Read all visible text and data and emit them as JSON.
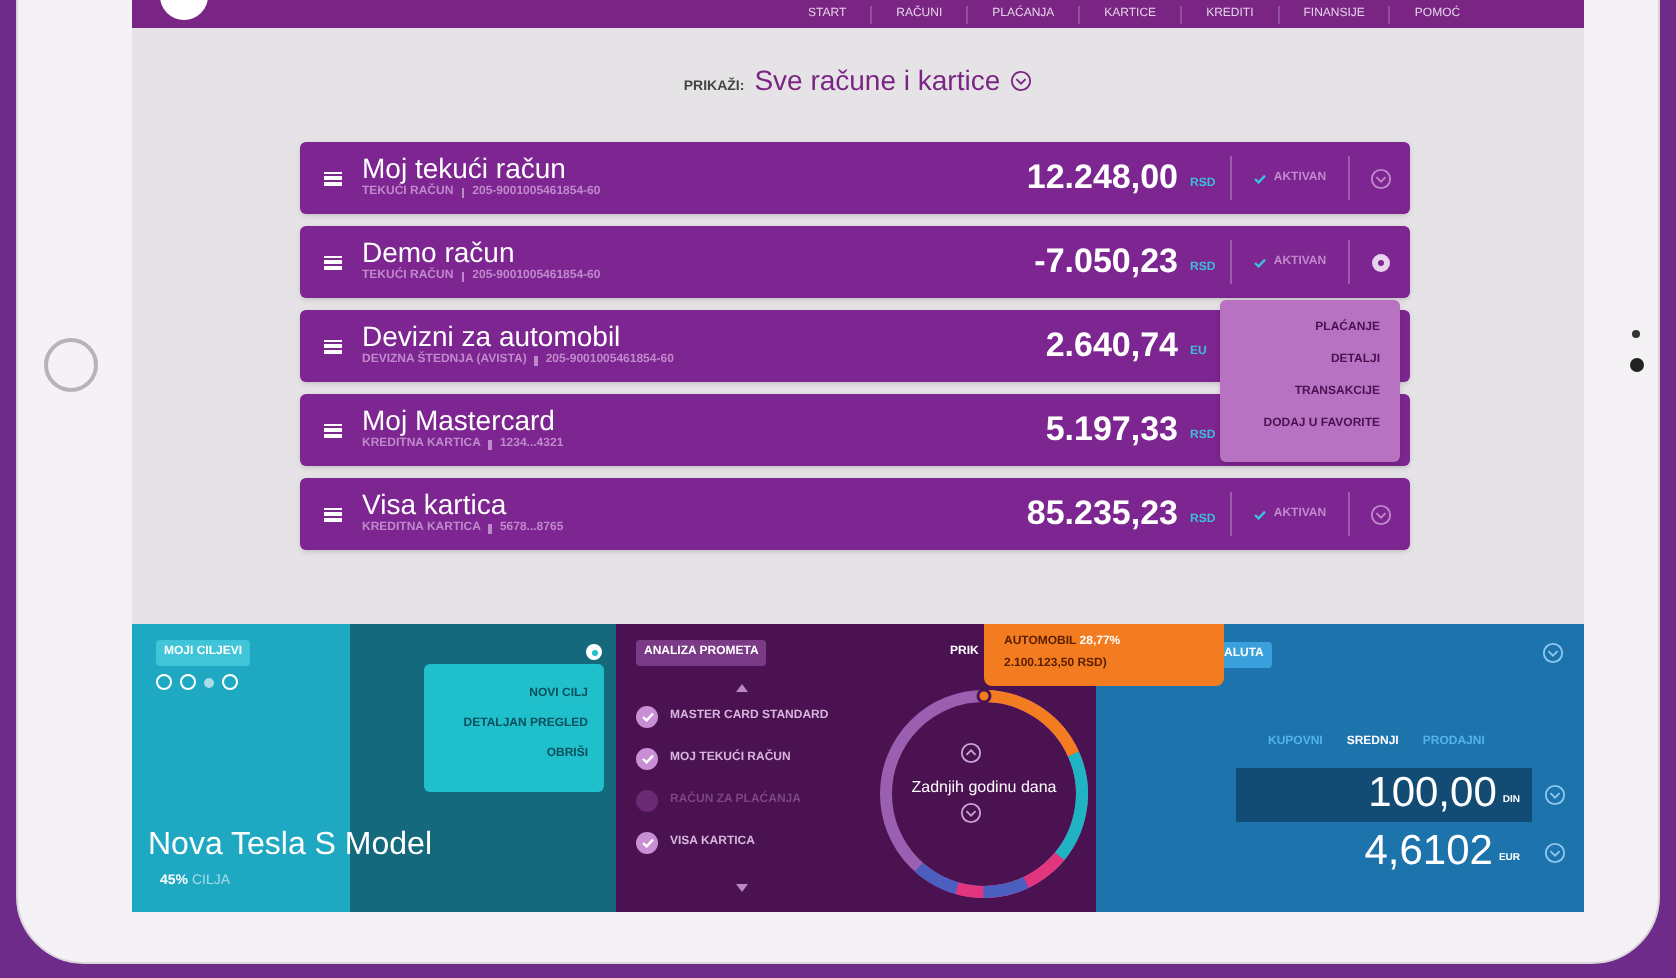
{
  "nav": {
    "items": [
      {
        "label": "START"
      },
      {
        "label": "RAČUNI"
      },
      {
        "label": "PLAĆANJA"
      },
      {
        "label": "KARTICE"
      },
      {
        "label": "KREDITI"
      },
      {
        "label": "FINANSIJE"
      },
      {
        "label": "POMOĆ"
      }
    ]
  },
  "filter": {
    "label": "PRIKAŽI:",
    "value": "Sve račune i kartice"
  },
  "accounts": [
    {
      "name": "Moj tekući račun",
      "type": "TEKUĆI RAČUN",
      "number": "205-9001005461854-60",
      "amount": "12.248,00",
      "currency": "RSD",
      "status": "AKTIVAN",
      "menu_open": false
    },
    {
      "name": "Demo račun",
      "type": "TEKUĆI RAČUN",
      "number": "205-9001005461854-60",
      "amount": "-7.050,23",
      "currency": "RSD",
      "status": "AKTIVAN",
      "menu_open": true
    },
    {
      "name": "Devizni za automobil",
      "type": "DEVIZNA ŠTEDNJA (AVISTA)",
      "number": "205-9001005461854-60",
      "amount": "2.640,74",
      "currency": "EU",
      "menu_open": false
    },
    {
      "name": "Moj Mastercard",
      "type": "KREDITNA KARTICA",
      "number": "1234...4321",
      "amount": "5.197,33",
      "currency": "RSD",
      "menu_open": false
    },
    {
      "name": "Visa kartica",
      "type": "KREDITNA KARTICA",
      "number": "5678...8765",
      "amount": "85.235,23",
      "currency": "RSD",
      "status": "AKTIVAN",
      "menu_open": false
    }
  ],
  "account_menu": {
    "items": [
      "PLAĆANJE",
      "DETALJI",
      "TRANSAKCIJE",
      "DODAJ U FAVORITE"
    ]
  },
  "goals": {
    "badge": "MOJI CILJEVI",
    "pages": [
      {
        "selected": false
      },
      {
        "selected": false
      },
      {
        "selected": true
      },
      {
        "selected": false
      }
    ],
    "title": "Nova Tesla S Model",
    "percent": "45%",
    "percent_label": "CILJA",
    "level": 0.45,
    "menu": [
      "NOVI CILJ",
      "DETALJAN PREGLED",
      "OBRIŠI"
    ]
  },
  "analysis": {
    "badge": "ANALIZA PROMETA",
    "view_label": "PRIK",
    "items": [
      {
        "label": "MASTER CARD STANDARD",
        "checked": true
      },
      {
        "label": "MOJ TEKUĆI RAČUN",
        "checked": true
      },
      {
        "label": "RAČUN ZA PLAĆANJA",
        "checked": false
      },
      {
        "label": "VISA KARTICA",
        "checked": true
      }
    ],
    "period": "Zadnjih godinu dana",
    "tooltip": {
      "label": "AUTOMOBIL",
      "percent": "28,77%",
      "amount": "2.100.123,50 RSD)"
    }
  },
  "currency": {
    "badge": "ALUTA",
    "tabs": [
      {
        "label": "KUPOVNI",
        "selected": false
      },
      {
        "label": "SREDNJI",
        "selected": true
      },
      {
        "label": "PRODAJNI",
        "selected": false
      }
    ],
    "rows": [
      {
        "value": "100,00",
        "unit": "DIN",
        "selected": true
      },
      {
        "value": "4,6102",
        "unit": "EUR",
        "selected": false
      }
    ]
  }
}
